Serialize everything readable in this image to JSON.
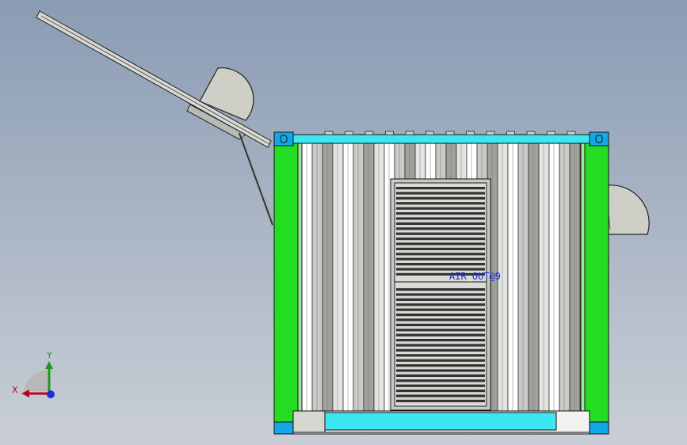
{
  "annotation": {
    "label": "AIR_OUT@9"
  },
  "triad": {
    "x_label": "X",
    "y_label": "Y"
  },
  "colors": {
    "frame_green": "#22dd22",
    "rail_cyan": "#3de6f0",
    "corner_blue": "#12a8e8",
    "panel_gray": "#d4d6d0",
    "dome_gray": "#cfcfc8",
    "louver_dark": "#333333",
    "label_blue": "#1a2fd6"
  }
}
